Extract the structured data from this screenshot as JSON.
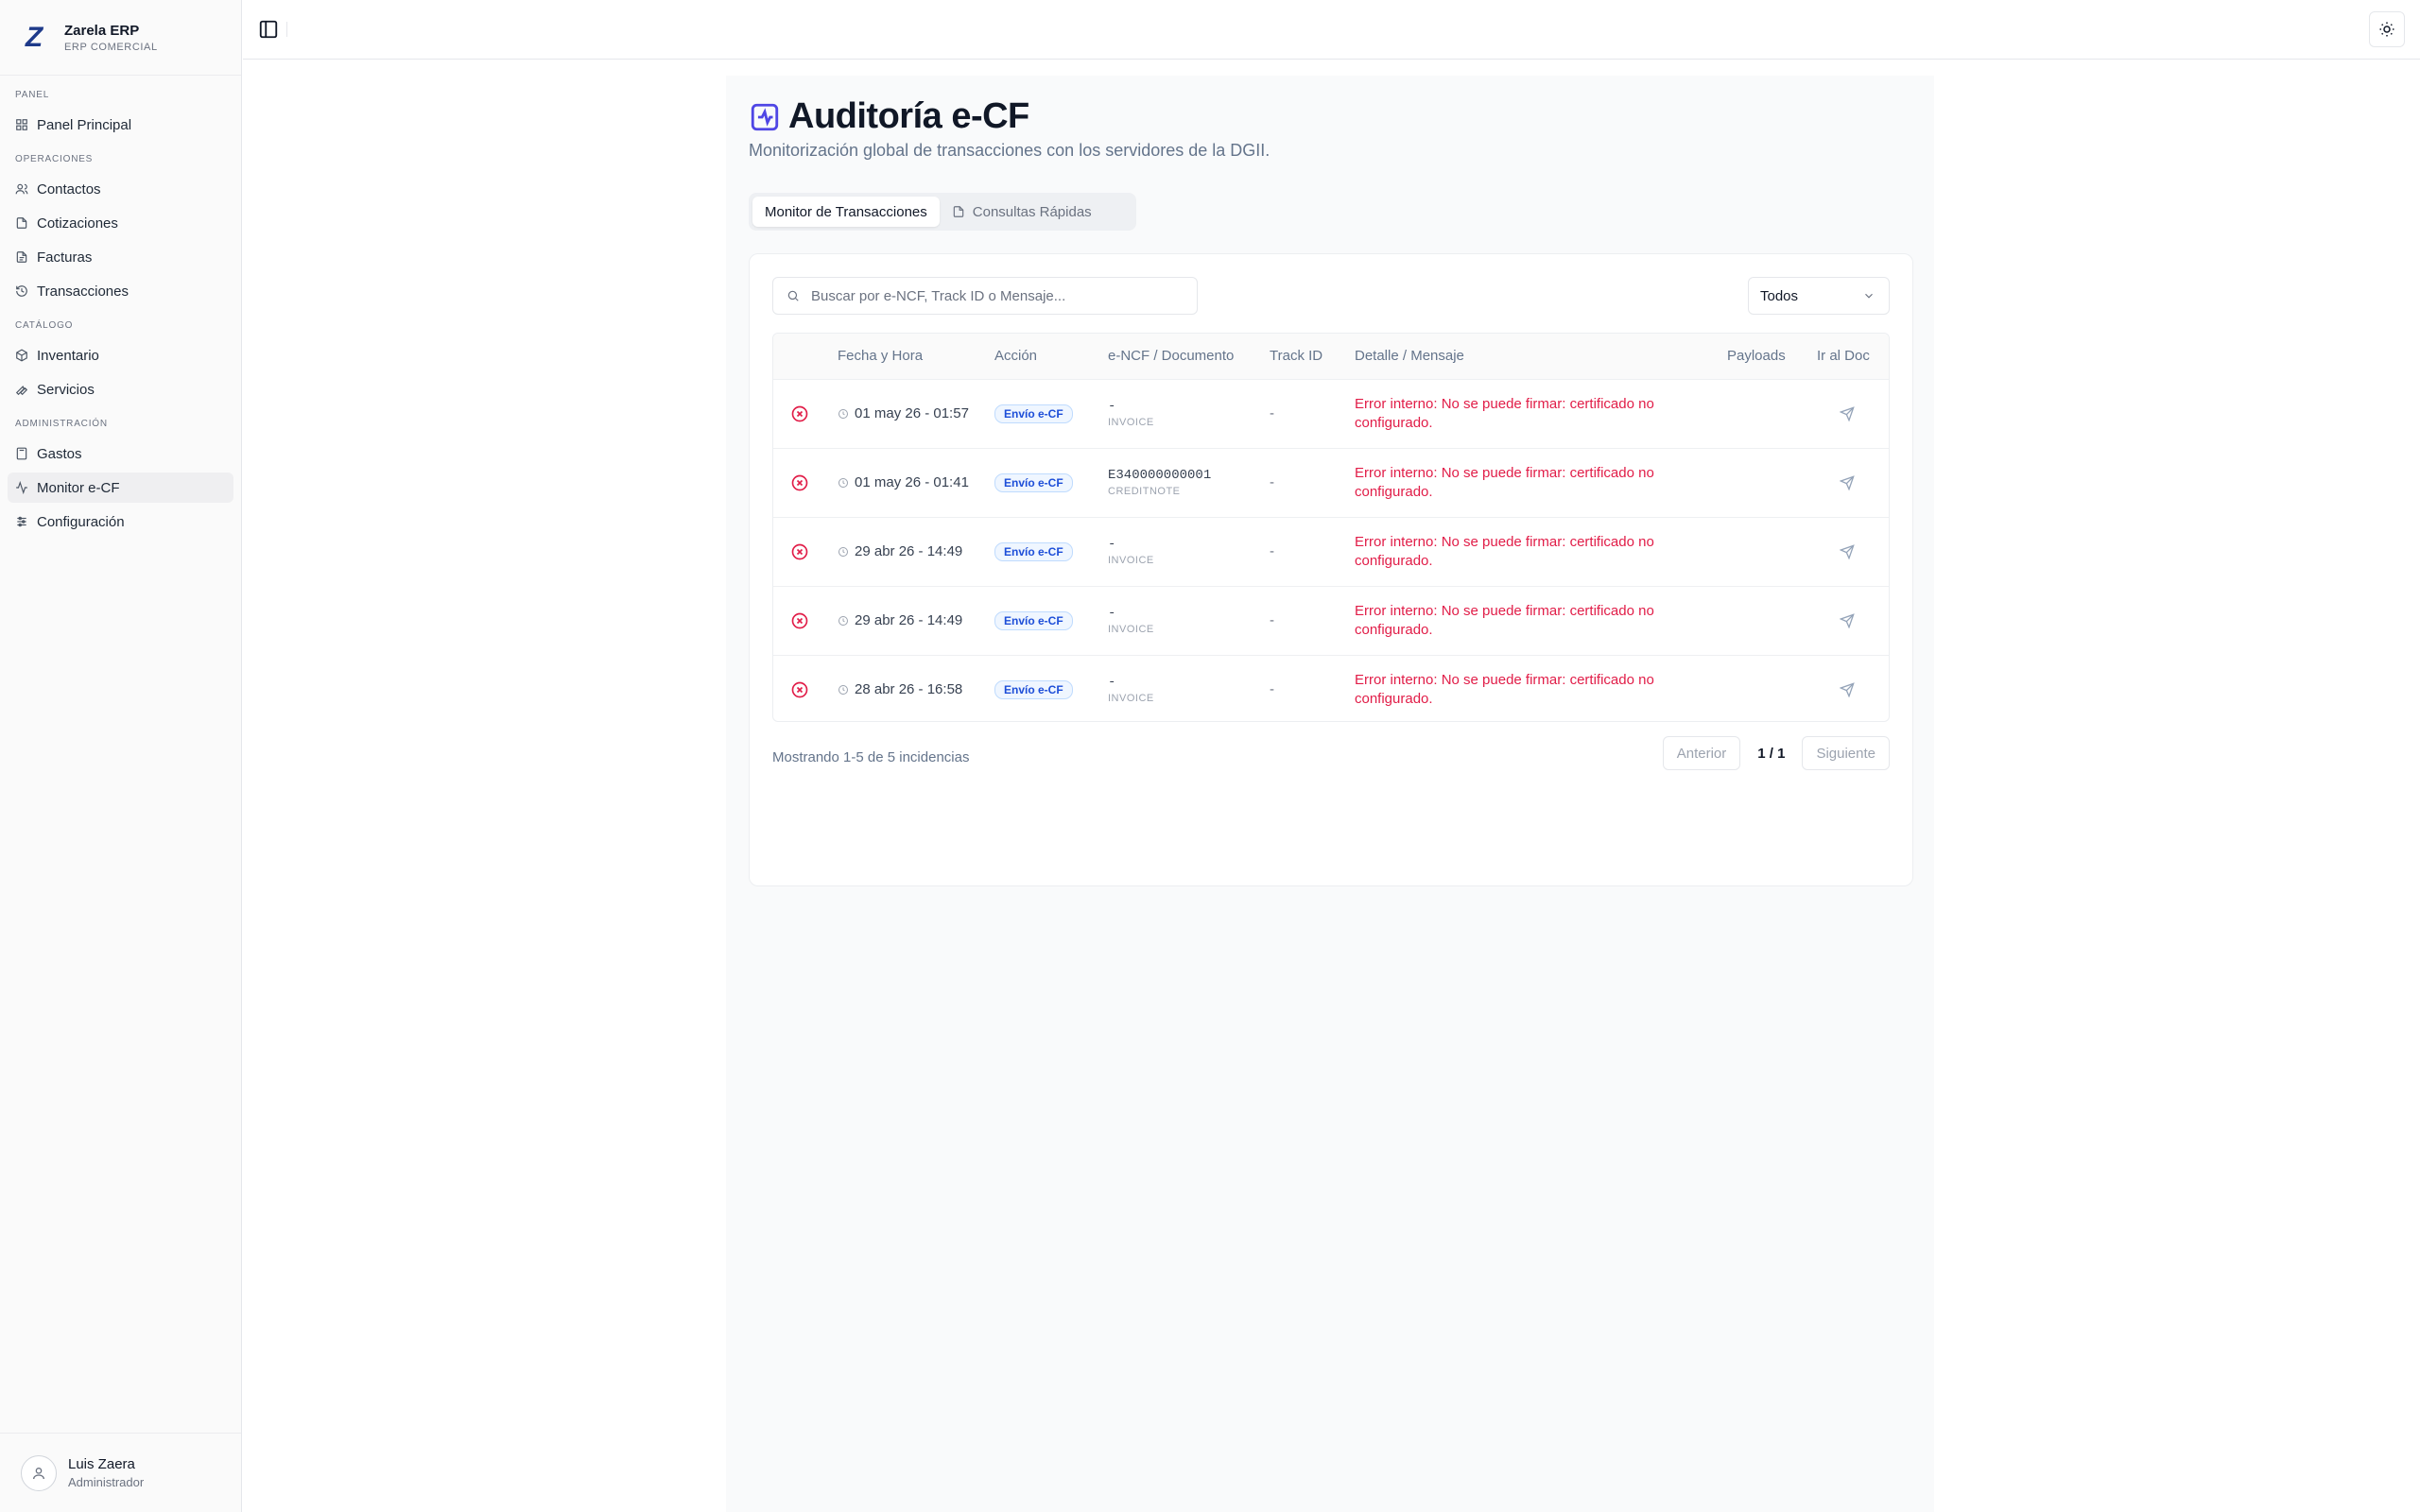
{
  "brand": {
    "logo_letter": "Z",
    "name": "Zarela ERP",
    "subtitle": "ERP COMERCIAL"
  },
  "sidebar": {
    "sections": [
      {
        "title": "PANEL",
        "items": [
          {
            "label": "Panel Principal",
            "icon": "grid-icon"
          }
        ]
      },
      {
        "title": "OPERACIONES",
        "items": [
          {
            "label": "Contactos",
            "icon": "users-icon"
          },
          {
            "label": "Cotizaciones",
            "icon": "file-icon"
          },
          {
            "label": "Facturas",
            "icon": "receipt-icon"
          },
          {
            "label": "Transacciones",
            "icon": "history-icon"
          }
        ]
      },
      {
        "title": "CATÁLOGO",
        "items": [
          {
            "label": "Inventario",
            "icon": "boxes-icon"
          },
          {
            "label": "Servicios",
            "icon": "wrench-icon"
          }
        ]
      },
      {
        "title": "ADMINISTRACIÓN",
        "items": [
          {
            "label": "Gastos",
            "icon": "calculator-icon"
          },
          {
            "label": "Monitor e-CF",
            "icon": "activity-icon",
            "active": true
          },
          {
            "label": "Configuración",
            "icon": "settings-icon"
          }
        ]
      }
    ]
  },
  "user": {
    "name": "Luis Zaera",
    "role": "Administrador"
  },
  "page": {
    "title": "Auditoría e-CF",
    "subtitle": "Monitorización global de transacciones con los servidores de la DGII.",
    "accent": "#4f46e5"
  },
  "tabs": [
    {
      "label": "Monitor de Transacciones",
      "active": true
    },
    {
      "label": "Consultas Rápidas",
      "active": false
    }
  ],
  "search": {
    "placeholder": "Buscar por e-NCF, Track ID o Mensaje..."
  },
  "filter": {
    "selected": "Todos"
  },
  "table": {
    "columns": [
      "",
      "Fecha y Hora",
      "Acción",
      "e-NCF / Documento",
      "Track ID",
      "Detalle / Mensaje",
      "Payloads",
      "Ir al Doc"
    ],
    "rows": [
      {
        "status": "error",
        "datetime": "01 may 26 - 01:57",
        "action": "Envío e-CF",
        "doc": "-",
        "doc_type": "INVOICE",
        "track": "-",
        "message": "Error interno: No se puede firmar: certificado no configurado."
      },
      {
        "status": "error",
        "datetime": "01 may 26 - 01:41",
        "action": "Envío e-CF",
        "doc": "E340000000001",
        "doc_type": "CREDITNOTE",
        "track": "-",
        "message": "Error interno: No se puede firmar: certificado no configurado."
      },
      {
        "status": "error",
        "datetime": "29 abr 26 - 14:49",
        "action": "Envío e-CF",
        "doc": "-",
        "doc_type": "INVOICE",
        "track": "-",
        "message": "Error interno: No se puede firmar: certificado no configurado."
      },
      {
        "status": "error",
        "datetime": "29 abr 26 - 14:49",
        "action": "Envío e-CF",
        "doc": "-",
        "doc_type": "INVOICE",
        "track": "-",
        "message": "Error interno: No se puede firmar: certificado no configurado."
      },
      {
        "status": "error",
        "datetime": "28 abr 26 - 16:58",
        "action": "Envío e-CF",
        "doc": "-",
        "doc_type": "INVOICE",
        "track": "-",
        "message": "Error interno: No se puede firmar: certificado no configurado."
      }
    ]
  },
  "pagination": {
    "summary": "Mostrando 1-5 de 5 incidencias",
    "prev": "Anterior",
    "page_info": "1 / 1",
    "next": "Siguiente"
  },
  "colors": {
    "error": "#e11d48",
    "badge_text": "#1d4ed8",
    "badge_bg": "#eff6ff"
  }
}
